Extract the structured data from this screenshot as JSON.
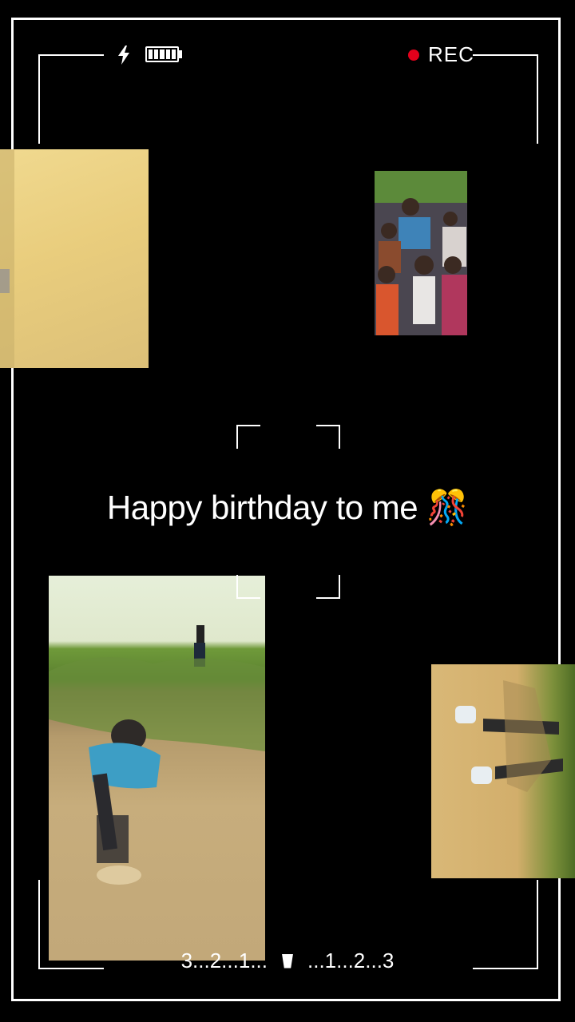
{
  "status": {
    "icons": [
      "flash-icon",
      "battery-icon",
      "record-dot-icon"
    ],
    "battery_level": 1.0,
    "rec_label": "REC",
    "rec_color": "#e3001b"
  },
  "caption": {
    "text": "Happy birthday to me 🎊"
  },
  "countdown": {
    "left": "3...2...1...",
    "right": "...1...2...3"
  },
  "photos": [
    {
      "name": "photo-left-top",
      "description_hint": "warm yellow blurred photo"
    },
    {
      "name": "photo-group",
      "description_hint": "group of people"
    },
    {
      "name": "photo-river",
      "description_hint": "person in river"
    },
    {
      "name": "photo-right-bottom",
      "description_hint": "feet on sand"
    }
  ]
}
